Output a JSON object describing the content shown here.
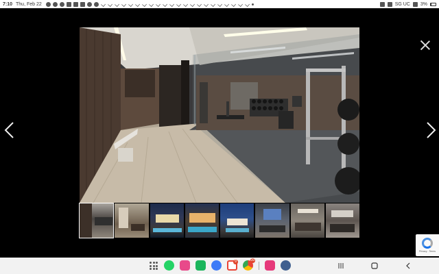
{
  "status_bar": {
    "time": "7:10",
    "date": "Thu, Feb 22",
    "carrier": "SG UC",
    "battery": "3%"
  },
  "viewer": {
    "close_icon": "close-icon",
    "prev_icon": "chevron-left-icon",
    "next_icon": "chevron-right-icon",
    "main_photo": "home gym with mirrored wall, dumbbell rack and wood floor",
    "active_thumbnail_index": 0,
    "thumbnail_count": 8
  },
  "recaptcha": {
    "terms": "Privacy - Terms"
  },
  "taskbar": {
    "apps": [
      {
        "icon": "whatsapp-icon",
        "color": "#25d366",
        "badge": ""
      },
      {
        "icon": "beeper-icon",
        "color": "#e84a8a",
        "badge": ""
      },
      {
        "icon": "phone-icon",
        "color": "#1bb55c",
        "badge": ""
      },
      {
        "icon": "messages-icon",
        "color": "#3d7bf7",
        "badge": ""
      },
      {
        "icon": "gmail-icon",
        "color": "#ea4335",
        "badge": "9"
      },
      {
        "icon": "chrome-icon",
        "color": "#fbbc05",
        "badge": "30"
      },
      {
        "icon": "flower-icon",
        "color": "#e6397a",
        "badge": ""
      },
      {
        "icon": "settings-icon",
        "color": "#3f5f8f",
        "badge": ""
      }
    ],
    "nav": [
      "recents-icon",
      "home-icon",
      "back-icon"
    ]
  }
}
